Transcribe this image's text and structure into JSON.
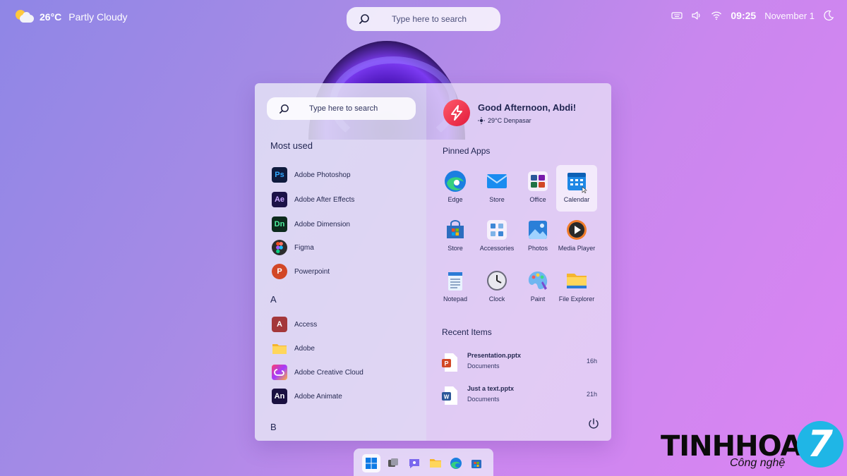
{
  "weather": {
    "temp": "26°C",
    "condition": "Partly Cloudy"
  },
  "top_search": {
    "placeholder": "Type here to search"
  },
  "system_tray": {
    "time": "09:25",
    "date": "November 1"
  },
  "start_menu": {
    "search": {
      "placeholder": "Type here to search"
    },
    "most_used_label": "Most used",
    "most_used": [
      {
        "label": "Adobe Photoshop",
        "abbr": "Ps"
      },
      {
        "label": "Adobe After Effects",
        "abbr": "Ae"
      },
      {
        "label": "Adobe Dimension",
        "abbr": "Dn"
      },
      {
        "label": "Figma",
        "abbr": ""
      },
      {
        "label": "Powerpoint",
        "abbr": "P"
      }
    ],
    "section_a": "A",
    "a_apps": [
      {
        "label": "Access",
        "abbr": "A"
      },
      {
        "label": "Adobe",
        "abbr": ""
      },
      {
        "label": "Adobe Creative Cloud",
        "abbr": ""
      },
      {
        "label": "Adobe Animate",
        "abbr": "An"
      }
    ],
    "section_b": "B",
    "greeting": {
      "title": "Good Afternoon, Abdi!",
      "weather": "29°C  Denpasar"
    },
    "pinned_label": "Pinned Apps",
    "pinned": [
      {
        "label": "Edge"
      },
      {
        "label": "Store"
      },
      {
        "label": "Office"
      },
      {
        "label": "Calendar"
      },
      {
        "label": "Store"
      },
      {
        "label": "Accessories"
      },
      {
        "label": "Photos"
      },
      {
        "label": "Media Player"
      },
      {
        "label": "Notepad"
      },
      {
        "label": "Clock"
      },
      {
        "label": "Paint"
      },
      {
        "label": "File Explorer"
      }
    ],
    "recent_label": "Recent Items",
    "recent": [
      {
        "name": "Presentation.pptx",
        "location": "Documents",
        "ago": "16h"
      },
      {
        "name": "Just a text.pptx",
        "location": "Documents",
        "ago": "21h"
      }
    ]
  },
  "brand": {
    "word": "TINHHOA",
    "tagline": "Công nghệ",
    "mark": "7"
  },
  "colors": {
    "accent": "#0078d4",
    "brand_blue": "#1fb6e6"
  }
}
